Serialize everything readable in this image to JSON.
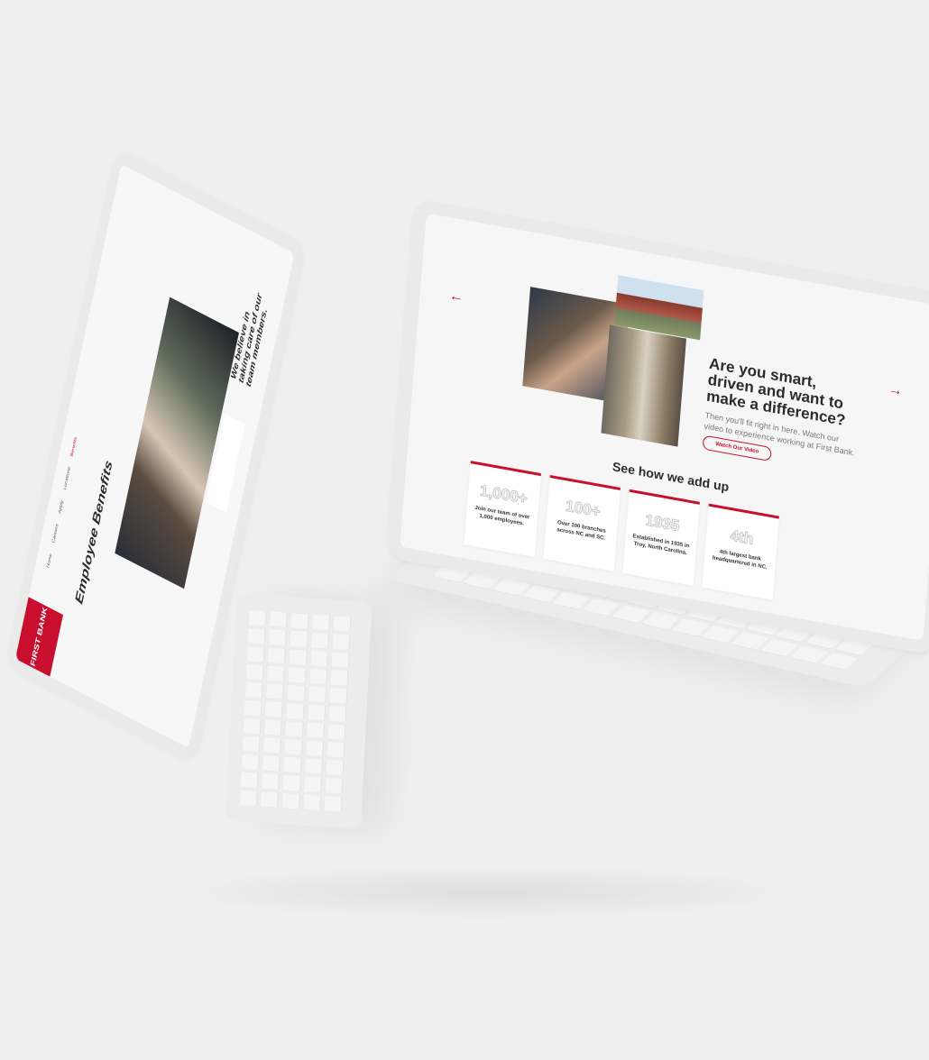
{
  "colors": {
    "accent": "#c8102e",
    "background": "#efefef"
  },
  "right_laptop": {
    "hero": {
      "arrow_left": "←",
      "arrow_right": "→",
      "title": "Are you smart, driven and want to make a difference?",
      "subtitle": "Then you'll fit right in here. Watch our video to experience working at First Bank.",
      "button": "Watch Our Video"
    },
    "stats": {
      "title": "See how we add up",
      "cards": [
        {
          "big": "1,000+",
          "small": "Join our team of over 1,000 employees."
        },
        {
          "big": "100+",
          "small": "Over 100 branches across NC and SC."
        },
        {
          "big": "1935",
          "small": "Established in 1935 in Troy, North Carolina."
        },
        {
          "big": "4th",
          "small": "4th largest bank headquartered in NC."
        }
      ]
    }
  },
  "left_laptop": {
    "logo": "FIRST BANK",
    "nav": [
      "Home",
      "Careers",
      "Apply",
      "Locations",
      "Benefits"
    ],
    "title": "Employee Benefits",
    "quote": "We believe in taking care of our team members."
  }
}
